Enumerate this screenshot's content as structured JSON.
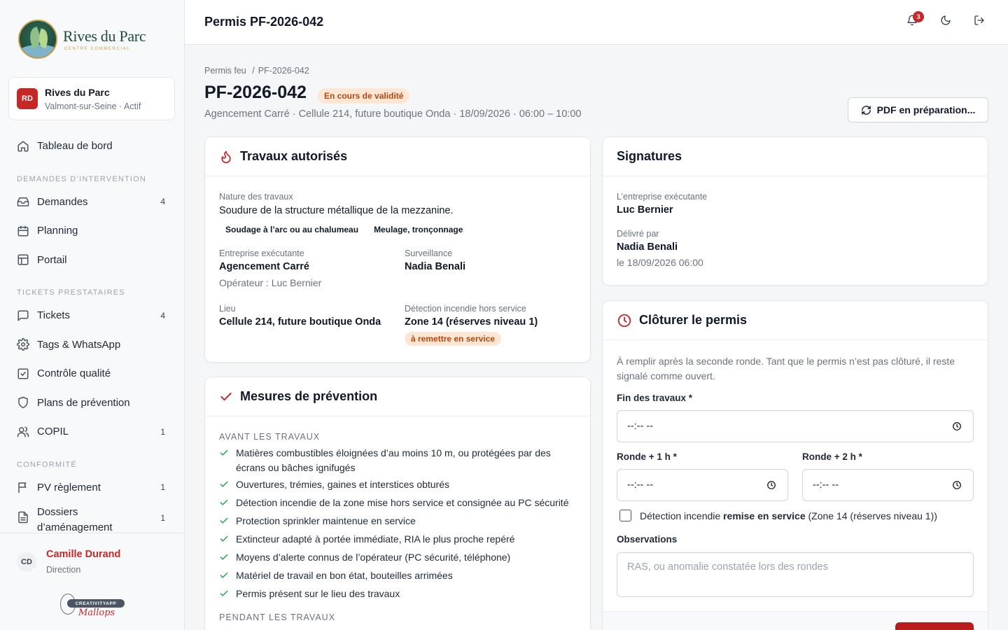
{
  "brand": {
    "name": "Rives du Parc",
    "tagline": "CENTRE COMMERCIAL"
  },
  "site": {
    "initials": "RD",
    "name": "Rives du Parc",
    "location": "Valmont-sur-Seine · Actif"
  },
  "nav": {
    "dashboard": "Tableau de bord",
    "section_demandes": "DEMANDES D’INTERVENTION",
    "demandes": {
      "label": "Demandes",
      "count": "4"
    },
    "planning": "Planning",
    "portail": "Portail",
    "section_tickets": "TICKETS PRESTATAIRES",
    "tickets": {
      "label": "Tickets",
      "count": "4"
    },
    "tags": "Tags & WhatsApp",
    "controle": "Contrôle qualité",
    "plans": "Plans de prévention",
    "copil": {
      "label": "COPIL",
      "count": "1"
    },
    "section_conformite": "CONFORMITÉ",
    "pv": {
      "label": "PV règlement",
      "count": "1"
    },
    "dossiers": {
      "label": "Dossiers d’aménagement",
      "count": "1"
    }
  },
  "user": {
    "initials": "CD",
    "name": "Camille Durand",
    "role": "Direction"
  },
  "footer_badge": {
    "label": "CREATIVITYAPP",
    "script": "Mallops"
  },
  "topbar": {
    "title": "Permis PF-2026-042",
    "notifications": "3"
  },
  "page": {
    "breadcrumb_root": "Permis feu",
    "breadcrumb_sep": "/",
    "breadcrumb_current": "PF-2026-042",
    "title": "PF-2026-042",
    "status": "En cours de validité",
    "subtitle": "Agencement Carré · Cellule 214, future boutique Onda · 18/09/2026 · 06:00 – 10:00",
    "pdf_button": "PDF en préparation..."
  },
  "travaux": {
    "title": "Travaux autorisés",
    "nature_label": "Nature des travaux",
    "nature_value": "Soudure de la structure métallique de la mezzanine.",
    "tags": [
      "Soudage à l’arc ou au chalumeau",
      "Meulage, tronçonnage"
    ],
    "entreprise_label": "Entreprise exécutante",
    "entreprise_value": "Agencement Carré",
    "operateur": "Opérateur : Luc Bernier",
    "surveillance_label": "Surveillance",
    "surveillance_value": "Nadia Benali",
    "lieu_label": "Lieu",
    "lieu_value": "Cellule 214, future boutique Onda",
    "detection_label": "Détection incendie hors service",
    "detection_value": "Zone 14 (réserves niveau 1)",
    "detection_tag": "à remettre en service"
  },
  "prevention": {
    "title": "Mesures de prévention",
    "section_avant": "AVANT LES TRAVAUX",
    "avant": [
      "Matières combustibles éloignées d’au moins 10 m, ou protégées par des écrans ou bâches ignifugés",
      "Ouvertures, trémies, gaines et interstices obturés",
      "Détection incendie de la zone mise hors service et consignée au PC sécurité",
      "Protection sprinkler maintenue en service",
      "Extincteur adapté à portée immédiate, RIA le plus proche repéré",
      "Moyens d’alerte connus de l’opérateur (PC sécurité, téléphone)",
      "Matériel de travail en bon état, bouteilles arrimées",
      "Permis présent sur le lieu des travaux"
    ],
    "section_pendant": "PENDANT LES TRAVAUX"
  },
  "signatures": {
    "title": "Signatures",
    "entreprise_label": "L’entreprise exécutante",
    "entreprise_value": "Luc Bernier",
    "delivre_label": "Délivré par",
    "delivre_value": "Nadia Benali",
    "delivre_date": "le 18/09/2026 06:00"
  },
  "cloture": {
    "title": "Clôturer le permis",
    "intro": "À remplir après la seconde ronde. Tant que le permis n’est pas clôturé, il reste signalé comme ouvert.",
    "fin_label": "Fin des travaux *",
    "fin_value": "--:-- --",
    "ronde1_label": "Ronde + 1 h *",
    "ronde1_value": "--:-- --",
    "ronde2_label": "Ronde + 2 h *",
    "ronde2_value": "--:-- --",
    "checkbox_pre": "Détection incendie",
    "checkbox_bold": "remise en service",
    "checkbox_post": "(Zone 14 (réserves niveau 1))",
    "observations_label": "Observations",
    "observations_placeholder": "RAS, ou anomalie constatée lors des rondes"
  },
  "colors": {
    "accent": "#c62828",
    "warning_bg": "#fde7d4",
    "warning_text": "#b4470f",
    "check": "#16a34a"
  }
}
